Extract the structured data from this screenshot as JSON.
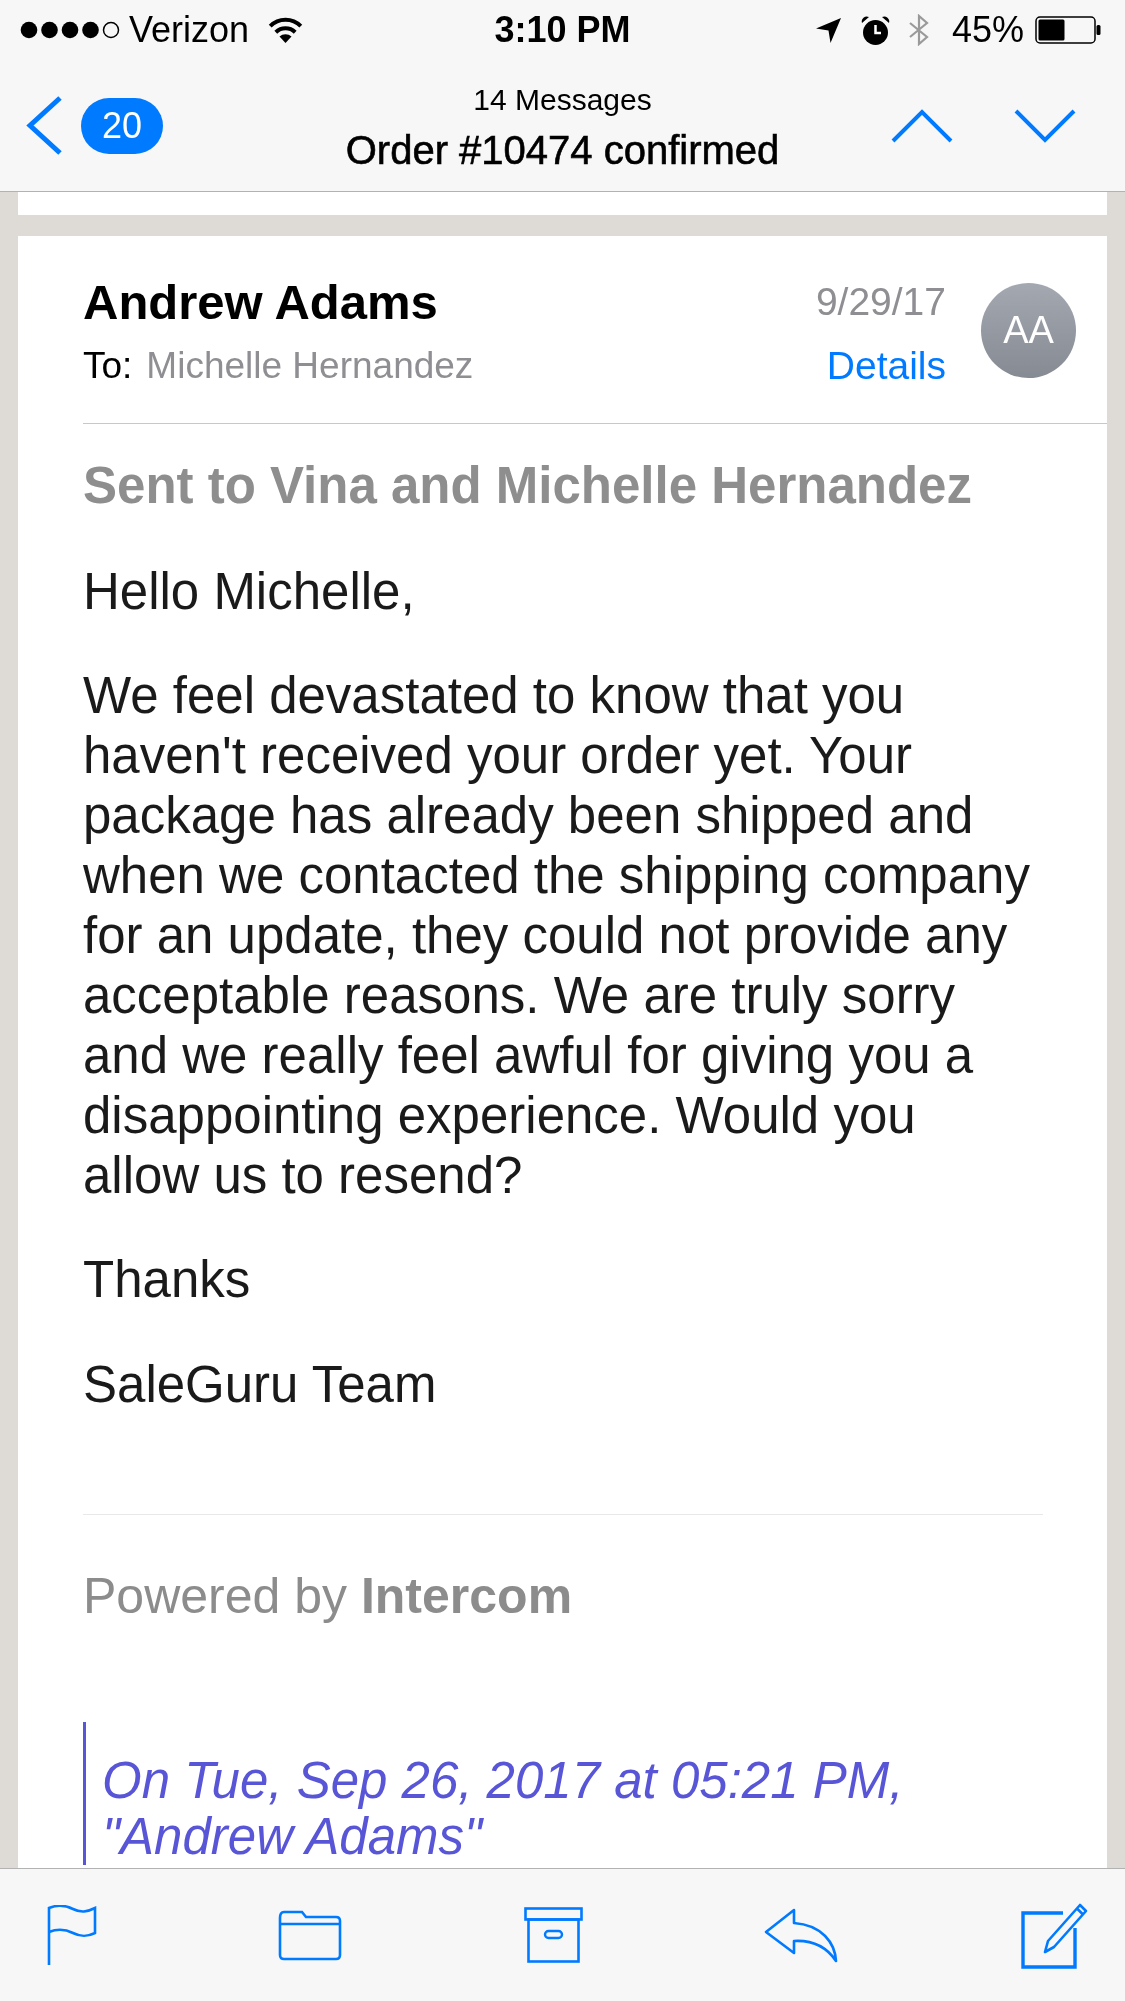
{
  "status_bar": {
    "carrier": "Verizon",
    "time": "3:10 PM",
    "battery": "45%"
  },
  "nav_bar": {
    "back_badge": "20",
    "subtitle": "14 Messages",
    "title": "Order #10474 confirmed"
  },
  "message": {
    "sender": "Andrew Adams",
    "to_label": "To:",
    "recipient": "Michelle Hernandez",
    "date": "9/29/17",
    "details_link": "Details",
    "avatar_initials": "AA",
    "body": {
      "heading": "Sent to Vina and Michelle Hernandez",
      "greeting": "Hello Michelle,",
      "paragraph": "We feel devastated to know that you haven't received your order yet. Your package has already been shipped and when we contacted the shipping company for an update, they could not provide any acceptable reasons. We are truly sorry and we really feel awful for giving you a disappointing experience. Would you allow us to resend?",
      "closing": "Thanks",
      "signature": "SaleGuru Team"
    },
    "footer": "Powered by **Intercom**",
    "quote_header": "On Tue, Sep 26, 2017 at 05:21 PM, \"Andrew Adams\""
  }
}
